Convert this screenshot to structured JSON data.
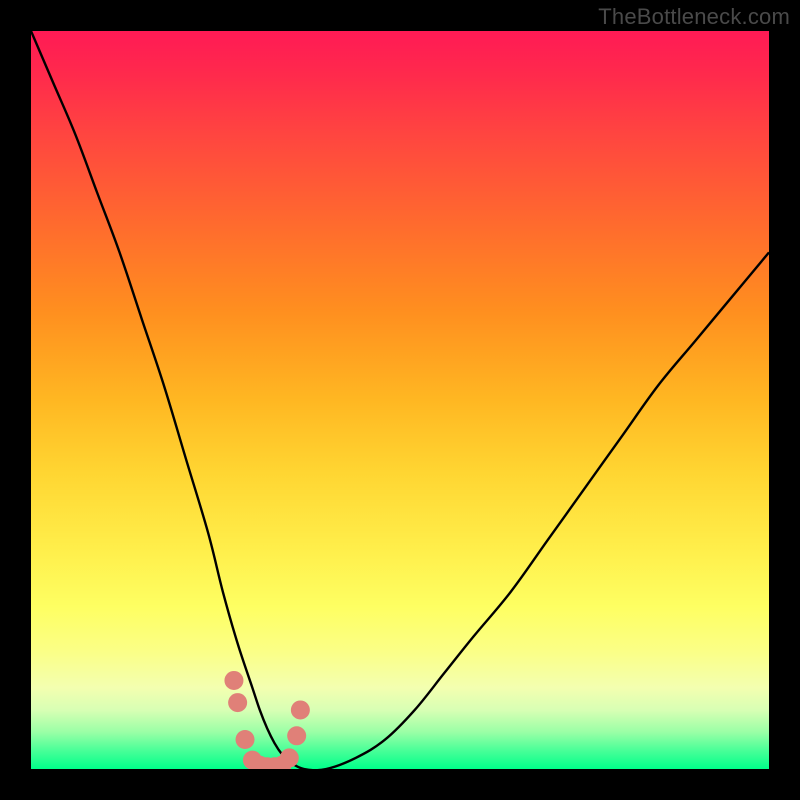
{
  "watermark": {
    "text": "TheBottleneck.com"
  },
  "colors": {
    "frame": "#000000",
    "curve": "#000000",
    "marker": "#e08078",
    "gradient_top": "#ff1a55",
    "gradient_bottom": "#00ff8a"
  },
  "chart_data": {
    "type": "line",
    "title": "",
    "xlabel": "",
    "ylabel": "",
    "xlim": [
      0,
      100
    ],
    "ylim": [
      0,
      100
    ],
    "grid": false,
    "legend": false,
    "x": [
      0,
      3,
      6,
      9,
      12,
      15,
      18,
      21,
      24,
      26,
      28,
      30,
      31,
      32,
      33,
      34,
      35,
      37,
      40,
      44,
      48,
      52,
      56,
      60,
      65,
      70,
      75,
      80,
      85,
      90,
      95,
      100
    ],
    "values": [
      100,
      93,
      86,
      78,
      70,
      61,
      52,
      42,
      32,
      24,
      17,
      11,
      8,
      5.5,
      3.5,
      2,
      1,
      0,
      0,
      1.5,
      4,
      8,
      13,
      18,
      24,
      31,
      38,
      45,
      52,
      58,
      64,
      70
    ],
    "markers": {
      "x": [
        27.5,
        28,
        29,
        30,
        31,
        32,
        33,
        34,
        35,
        36,
        36.5
      ],
      "y": [
        12,
        9,
        4,
        1.2,
        0.5,
        0.3,
        0.3,
        0.5,
        1.5,
        4.5,
        8
      ]
    },
    "note": "Values are approximate percentages read off the unlabeled gradient axes; y=0 is the bottom (green) and y=100 the top (red)."
  }
}
